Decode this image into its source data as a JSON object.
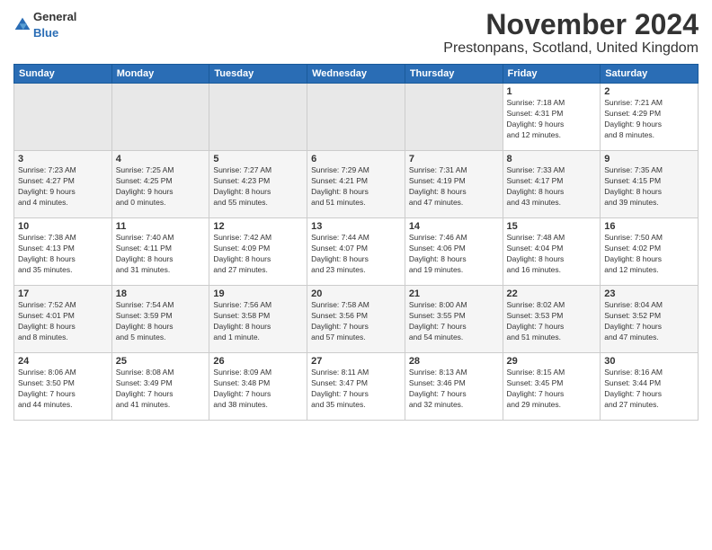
{
  "logo": {
    "general": "General",
    "blue": "Blue"
  },
  "title": "November 2024",
  "subtitle": "Prestonpans, Scotland, United Kingdom",
  "headers": [
    "Sunday",
    "Monday",
    "Tuesday",
    "Wednesday",
    "Thursday",
    "Friday",
    "Saturday"
  ],
  "weeks": [
    [
      {
        "day": "",
        "info": "",
        "empty": true
      },
      {
        "day": "",
        "info": "",
        "empty": true
      },
      {
        "day": "",
        "info": "",
        "empty": true
      },
      {
        "day": "",
        "info": "",
        "empty": true
      },
      {
        "day": "",
        "info": "",
        "empty": true
      },
      {
        "day": "1",
        "info": "Sunrise: 7:18 AM\nSunset: 4:31 PM\nDaylight: 9 hours\nand 12 minutes."
      },
      {
        "day": "2",
        "info": "Sunrise: 7:21 AM\nSunset: 4:29 PM\nDaylight: 9 hours\nand 8 minutes."
      }
    ],
    [
      {
        "day": "3",
        "info": "Sunrise: 7:23 AM\nSunset: 4:27 PM\nDaylight: 9 hours\nand 4 minutes."
      },
      {
        "day": "4",
        "info": "Sunrise: 7:25 AM\nSunset: 4:25 PM\nDaylight: 9 hours\nand 0 minutes."
      },
      {
        "day": "5",
        "info": "Sunrise: 7:27 AM\nSunset: 4:23 PM\nDaylight: 8 hours\nand 55 minutes."
      },
      {
        "day": "6",
        "info": "Sunrise: 7:29 AM\nSunset: 4:21 PM\nDaylight: 8 hours\nand 51 minutes."
      },
      {
        "day": "7",
        "info": "Sunrise: 7:31 AM\nSunset: 4:19 PM\nDaylight: 8 hours\nand 47 minutes."
      },
      {
        "day": "8",
        "info": "Sunrise: 7:33 AM\nSunset: 4:17 PM\nDaylight: 8 hours\nand 43 minutes."
      },
      {
        "day": "9",
        "info": "Sunrise: 7:35 AM\nSunset: 4:15 PM\nDaylight: 8 hours\nand 39 minutes."
      }
    ],
    [
      {
        "day": "10",
        "info": "Sunrise: 7:38 AM\nSunset: 4:13 PM\nDaylight: 8 hours\nand 35 minutes."
      },
      {
        "day": "11",
        "info": "Sunrise: 7:40 AM\nSunset: 4:11 PM\nDaylight: 8 hours\nand 31 minutes."
      },
      {
        "day": "12",
        "info": "Sunrise: 7:42 AM\nSunset: 4:09 PM\nDaylight: 8 hours\nand 27 minutes."
      },
      {
        "day": "13",
        "info": "Sunrise: 7:44 AM\nSunset: 4:07 PM\nDaylight: 8 hours\nand 23 minutes."
      },
      {
        "day": "14",
        "info": "Sunrise: 7:46 AM\nSunset: 4:06 PM\nDaylight: 8 hours\nand 19 minutes."
      },
      {
        "day": "15",
        "info": "Sunrise: 7:48 AM\nSunset: 4:04 PM\nDaylight: 8 hours\nand 16 minutes."
      },
      {
        "day": "16",
        "info": "Sunrise: 7:50 AM\nSunset: 4:02 PM\nDaylight: 8 hours\nand 12 minutes."
      }
    ],
    [
      {
        "day": "17",
        "info": "Sunrise: 7:52 AM\nSunset: 4:01 PM\nDaylight: 8 hours\nand 8 minutes."
      },
      {
        "day": "18",
        "info": "Sunrise: 7:54 AM\nSunset: 3:59 PM\nDaylight: 8 hours\nand 5 minutes."
      },
      {
        "day": "19",
        "info": "Sunrise: 7:56 AM\nSunset: 3:58 PM\nDaylight: 8 hours\nand 1 minute."
      },
      {
        "day": "20",
        "info": "Sunrise: 7:58 AM\nSunset: 3:56 PM\nDaylight: 7 hours\nand 57 minutes."
      },
      {
        "day": "21",
        "info": "Sunrise: 8:00 AM\nSunset: 3:55 PM\nDaylight: 7 hours\nand 54 minutes."
      },
      {
        "day": "22",
        "info": "Sunrise: 8:02 AM\nSunset: 3:53 PM\nDaylight: 7 hours\nand 51 minutes."
      },
      {
        "day": "23",
        "info": "Sunrise: 8:04 AM\nSunset: 3:52 PM\nDaylight: 7 hours\nand 47 minutes."
      }
    ],
    [
      {
        "day": "24",
        "info": "Sunrise: 8:06 AM\nSunset: 3:50 PM\nDaylight: 7 hours\nand 44 minutes."
      },
      {
        "day": "25",
        "info": "Sunrise: 8:08 AM\nSunset: 3:49 PM\nDaylight: 7 hours\nand 41 minutes."
      },
      {
        "day": "26",
        "info": "Sunrise: 8:09 AM\nSunset: 3:48 PM\nDaylight: 7 hours\nand 38 minutes."
      },
      {
        "day": "27",
        "info": "Sunrise: 8:11 AM\nSunset: 3:47 PM\nDaylight: 7 hours\nand 35 minutes."
      },
      {
        "day": "28",
        "info": "Sunrise: 8:13 AM\nSunset: 3:46 PM\nDaylight: 7 hours\nand 32 minutes."
      },
      {
        "day": "29",
        "info": "Sunrise: 8:15 AM\nSunset: 3:45 PM\nDaylight: 7 hours\nand 29 minutes."
      },
      {
        "day": "30",
        "info": "Sunrise: 8:16 AM\nSunset: 3:44 PM\nDaylight: 7 hours\nand 27 minutes."
      }
    ]
  ]
}
